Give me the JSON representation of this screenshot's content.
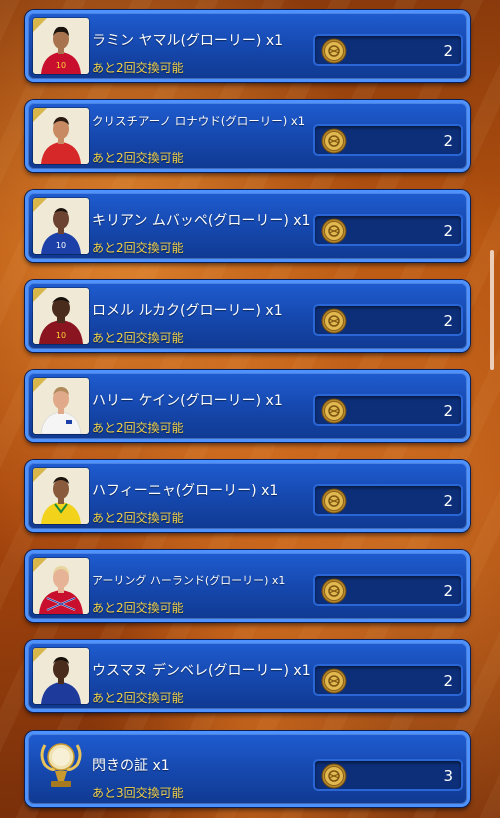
{
  "items": [
    {
      "name": "ラミン ヤマル(グローリー) x1",
      "remaining": "あと2回交換可能",
      "cost": "2",
      "icon": "player-yamal-photo",
      "shirt": "#c8102e",
      "skin": "#a8744f",
      "hair": "#1a120c"
    },
    {
      "name": "クリスチアーノ ロナウド(グローリー) x1",
      "remaining": "あと2回交換可能",
      "cost": "2",
      "icon": "player-ronaldo-photo",
      "shirt": "#d62828",
      "skin": "#c88a62",
      "hair": "#2a1a10"
    },
    {
      "name": "キリアン ムバッペ(グローリー) x1",
      "remaining": "あと2回交換可能",
      "cost": "2",
      "icon": "player-mbappe-photo",
      "shirt": "#1d3fa8",
      "skin": "#6b4330",
      "hair": "#1a120c"
    },
    {
      "name": "ロメル ルカク(グローリー) x1",
      "remaining": "あと2回交換可能",
      "cost": "2",
      "icon": "player-lukaku-photo",
      "shirt": "#8a1420",
      "skin": "#4a2c1c",
      "hair": "#15100a"
    },
    {
      "name": "ハリー ケイン(グローリー) x1",
      "remaining": "あと2回交換可能",
      "cost": "2",
      "icon": "player-kane-photo",
      "shirt": "#f5f5f5",
      "skin": "#e0a98a",
      "hair": "#b08a5a"
    },
    {
      "name": "ハフィーニャ(グローリー) x1",
      "remaining": "あと2回交換可能",
      "cost": "2",
      "icon": "player-raphinha-photo",
      "shirt": "#f2d21a",
      "skin": "#8a5a3c",
      "hair": "#1a120c"
    },
    {
      "name": "アーリング ハーランド(グローリー) x1",
      "remaining": "あと2回交換可能",
      "cost": "2",
      "icon": "player-haaland-photo",
      "shirt": "#c8102e",
      "skin": "#e6b396",
      "hair": "#e8d6a0"
    },
    {
      "name": "ウスマヌ デンベレ(グローリー) x1",
      "remaining": "あと2回交換可能",
      "cost": "2",
      "icon": "player-dembele-photo",
      "shirt": "#1e3a9a",
      "skin": "#4a2c1c",
      "hair": "#15100a"
    },
    {
      "name": "閃きの証 x1",
      "remaining": "あと3回交換可能",
      "cost": "3",
      "icon": "trophy-icon",
      "stars": "★★★★★"
    }
  ],
  "colors": {
    "card": "#1547ac",
    "card_border": "#4e92ff",
    "accent_text": "#f2d34a",
    "coin": "#d4a640"
  }
}
